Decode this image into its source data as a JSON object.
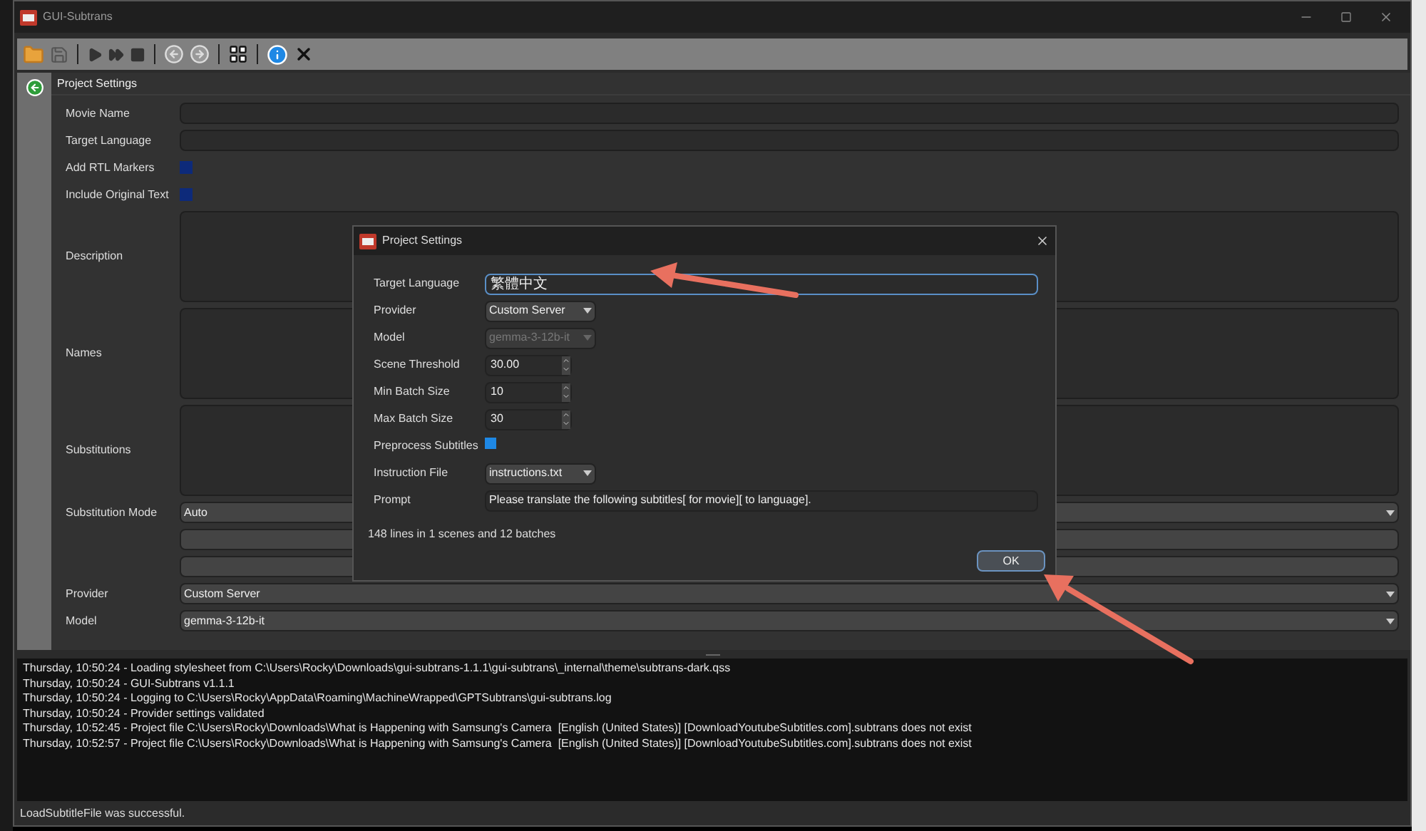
{
  "window": {
    "title": "GUI-Subtrans"
  },
  "panel": {
    "title": "Project Settings"
  },
  "fields": [
    {
      "kind": "text",
      "label": "Movie Name"
    },
    {
      "kind": "text",
      "label": "Target Language"
    },
    {
      "kind": "checkbox",
      "label": "Add RTL Markers",
      "checked": false
    },
    {
      "kind": "checkbox",
      "label": "Include Original Text",
      "checked": false
    },
    {
      "kind": "textarea",
      "label": "Description"
    },
    {
      "kind": "textarea",
      "label": "Names"
    },
    {
      "kind": "textarea",
      "label": "Substitutions"
    },
    {
      "kind": "combo",
      "label": "Substitution Mode",
      "value": "Auto"
    },
    {
      "kind": "bar"
    },
    {
      "kind": "bar"
    },
    {
      "kind": "combo",
      "label": "Provider",
      "value": "Custom Server"
    },
    {
      "kind": "combo",
      "label": "Model",
      "value": "gemma-3-12b-it"
    }
  ],
  "dialog": {
    "title": "Project Settings",
    "fields": [
      {
        "kind": "text",
        "label": "Target Language",
        "value": "繁體中文",
        "focused": true
      },
      {
        "kind": "combo",
        "label": "Provider",
        "value": "Custom Server",
        "disabled": false
      },
      {
        "kind": "combo",
        "label": "Model",
        "value": "gemma-3-12b-it",
        "disabled": true
      },
      {
        "kind": "spin",
        "label": "Scene Threshold",
        "value": "30.00"
      },
      {
        "kind": "spin",
        "label": "Min Batch Size",
        "value": "10"
      },
      {
        "kind": "spin",
        "label": "Max Batch Size",
        "value": "30"
      },
      {
        "kind": "checkbox",
        "label": "Preprocess Subtitles",
        "checked": true
      },
      {
        "kind": "combo",
        "label": "Instruction File",
        "value": "instructions.txt",
        "disabled": false
      },
      {
        "kind": "prompt",
        "label": "Prompt",
        "value": "Please translate the following subtitles[ for movie][ to language]."
      }
    ],
    "summary": "148 lines in 1 scenes and 12 batches",
    "ok_button": "OK"
  },
  "log": [
    "Thursday, 10:50:24 - Loading stylesheet from C:\\Users\\Rocky\\Downloads\\gui-subtrans-1.1.1\\gui-subtrans\\_internal\\theme\\subtrans-dark.qss",
    "Thursday, 10:50:24 - GUI-Subtrans v1.1.1",
    "Thursday, 10:50:24 - Logging to C:\\Users\\Rocky\\AppData\\Roaming\\MachineWrapped\\GPTSubtrans\\gui-subtrans.log",
    "Thursday, 10:50:24 - Provider settings validated",
    "Thursday, 10:52:45 - Project file C:\\Users\\Rocky\\Downloads\\What is Happening with Samsung's Camera  [English (United States)] [DownloadYoutubeSubtitles.com].subtrans does not exist",
    "Thursday, 10:52:57 - Project file C:\\Users\\Rocky\\Downloads\\What is Happening with Samsung's Camera  [English (United States)] [DownloadYoutubeSubtitles.com].subtrans does not exist"
  ],
  "status_bar": "LoadSubtitleFile was successful."
}
